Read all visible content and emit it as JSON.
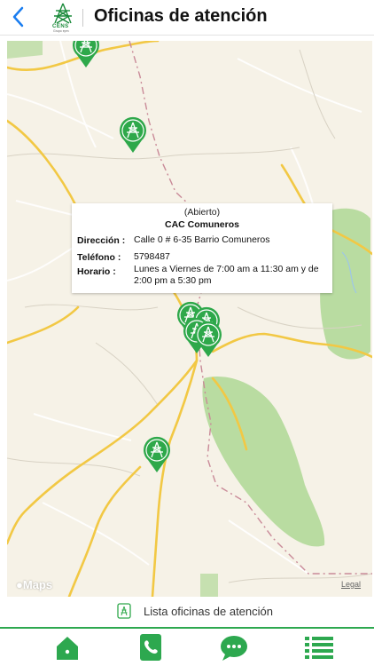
{
  "header": {
    "title": "Oficinas de atención",
    "logo_text": "CENS",
    "logo_subtext": "Grupo epm"
  },
  "map": {
    "callout": {
      "status": "(Abierto)",
      "name": "CAC Comuneros",
      "address_label": "Dirección :",
      "address": "Calle 0 # 6-35 Barrio Comuneros",
      "phone_label": "Teléfono :",
      "phone": "5798487",
      "hours_label": "Horario :",
      "hours": "Lunes a Viernes de 7:00 am a 11:30 am y de 2:00 pm a 5:30 pm"
    },
    "brand": "Maps",
    "legal": "Legal",
    "pin_icon": "electric-tower-icon",
    "colors": {
      "pin": "#2ea84a",
      "park": "#b9dca1",
      "road": "#f2c844",
      "border_line": "#c98a98"
    }
  },
  "list_link": {
    "label": "Lista oficinas de atención"
  },
  "tabbar": {
    "items": [
      {
        "icon": "home-icon"
      },
      {
        "icon": "phone-icon"
      },
      {
        "icon": "chat-icon"
      },
      {
        "icon": "list-icon"
      }
    ],
    "color": "#2da84f"
  }
}
